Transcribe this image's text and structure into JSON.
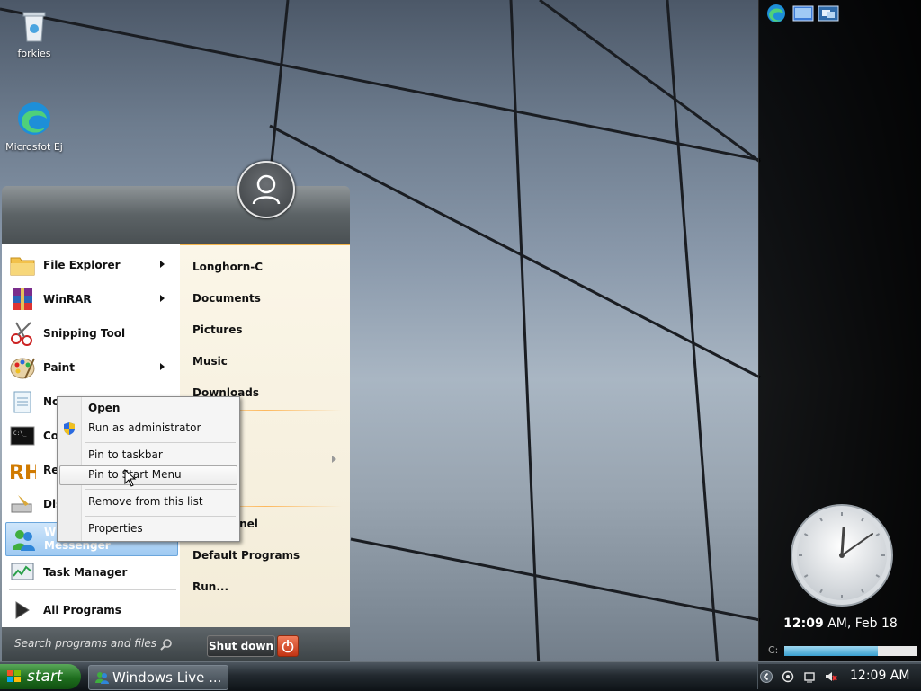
{
  "desktop": {
    "icons": [
      {
        "label": "forkies",
        "icon": "recycle-bin-icon"
      },
      {
        "label": "Microsfot Ej",
        "icon": "edge-icon"
      }
    ]
  },
  "start_menu": {
    "programs": [
      {
        "label": "File Explorer",
        "icon": "folder-icon",
        "submenu": true
      },
      {
        "label": "WinRAR",
        "icon": "winrar-icon",
        "submenu": true
      },
      {
        "label": "Snipping Tool",
        "icon": "scissors-icon",
        "submenu": false
      },
      {
        "label": "Paint",
        "icon": "paint-palette-icon",
        "submenu": true
      },
      {
        "label": "No",
        "icon": "notepad-icon",
        "submenu": false
      },
      {
        "label": "Co",
        "icon": "cmd-icon",
        "submenu": false
      },
      {
        "label": "Re",
        "icon": "resource-hacker-icon",
        "submenu": false
      },
      {
        "label": "Dis",
        "icon": "disk-cleanup-icon",
        "submenu": false
      },
      {
        "label": "Wi",
        "label_line2": "Messenger",
        "icon": "messenger-icon",
        "submenu": true
      },
      {
        "label": "Task Manager",
        "icon": "task-manager-icon",
        "submenu": false
      }
    ],
    "all_programs": "All Programs",
    "right_links": [
      "Longhorn-C",
      "Documents",
      "Pictures",
      "Music",
      "Downloads",
      "r",
      "anel",
      "Default Programs",
      "Run..."
    ],
    "search_placeholder": "Search programs and files",
    "shutdown_label": "Shut down"
  },
  "context_menu": {
    "items": [
      "Open",
      "Run as administrator",
      "Pin to taskbar",
      "Pin to Start Menu",
      "Remove from this list",
      "Properties"
    ]
  },
  "taskbar": {
    "start_label": "start",
    "task_label": "Windows Live ...",
    "time": "12:09 AM"
  },
  "sidebar": {
    "clock_time": "12:09",
    "clock_rest": " AM, Feb 18",
    "drive_label": "C:",
    "drive_usage": 0.7
  },
  "colors": {
    "start_green": "#1e6e1e",
    "menu_accent": "#f5b54a",
    "selection": "#9fcaf2"
  }
}
